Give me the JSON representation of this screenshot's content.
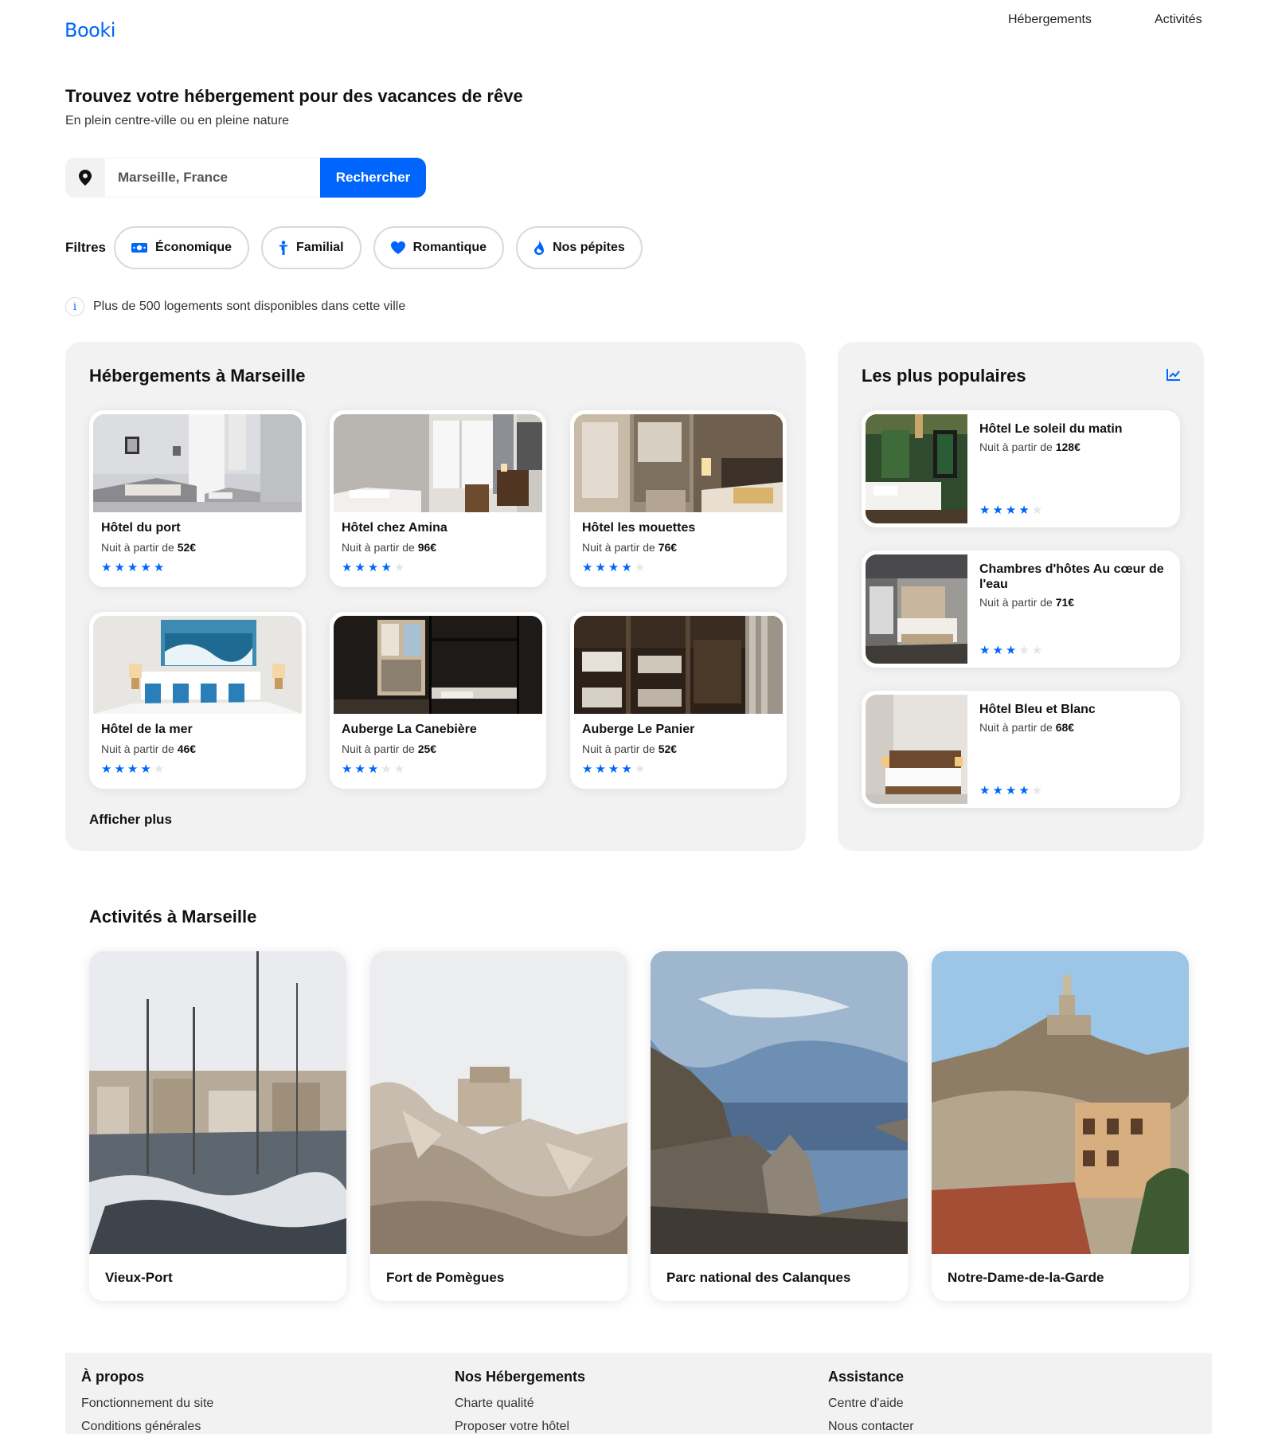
{
  "brand": {
    "logo": "Booki",
    "accent": "#0065fc"
  },
  "nav": {
    "items": [
      "Hébergements",
      "Activités"
    ]
  },
  "hero": {
    "title": "Trouvez votre hébergement pour des vacances de rêve",
    "subtitle": "En plein centre-ville ou en pleine nature"
  },
  "search": {
    "value": "Marseille, France",
    "button": "Rechercher",
    "icon": "map-pin-icon"
  },
  "filters": {
    "label": "Filtres",
    "chips": [
      {
        "label": "Économique",
        "icon": "money-icon"
      },
      {
        "label": "Familial",
        "icon": "child-icon"
      },
      {
        "label": "Romantique",
        "icon": "heart-icon"
      },
      {
        "label": "Nos pépites",
        "icon": "fire-icon"
      }
    ]
  },
  "info": {
    "text": "Plus de 500 logements sont disponibles dans cette ville",
    "icon": "info-icon"
  },
  "hebergements": {
    "title": "Hébergements à Marseille",
    "price_prefix": "Nuit à partir de",
    "more": "Afficher plus",
    "items": [
      {
        "name": "Hôtel du port",
        "price": "52€",
        "stars": 5
      },
      {
        "name": "Hôtel chez Amina",
        "price": "96€",
        "stars": 4
      },
      {
        "name": "Hôtel les mouettes",
        "price": "76€",
        "stars": 4
      },
      {
        "name": "Hôtel de la mer",
        "price": "46€",
        "stars": 4
      },
      {
        "name": "Auberge La Canebière",
        "price": "25€",
        "stars": 3
      },
      {
        "name": "Auberge Le Panier",
        "price": "52€",
        "stars": 4
      }
    ]
  },
  "populaires": {
    "title": "Les plus populaires",
    "icon": "chart-line-icon",
    "price_prefix": "Nuit à partir de",
    "items": [
      {
        "name": "Hôtel Le soleil du matin",
        "price": "128€",
        "stars": 4
      },
      {
        "name": "Chambres d'hôtes Au cœur de l'eau",
        "price": "71€",
        "stars": 3
      },
      {
        "name": "Hôtel Bleu et Blanc",
        "price": "68€",
        "stars": 4
      }
    ]
  },
  "activites": {
    "title": "Activités à Marseille",
    "items": [
      "Vieux-Port",
      "Fort de Pomègues",
      "Parc national des Calanques",
      "Notre-Dame-de-la-Garde"
    ]
  },
  "footer": {
    "columns": [
      {
        "title": "À propos",
        "links": [
          "Fonctionnement du site",
          "Conditions générales"
        ]
      },
      {
        "title": "Nos Hébergements",
        "links": [
          "Charte qualité",
          "Proposer votre hôtel"
        ]
      },
      {
        "title": "Assistance",
        "links": [
          "Centre d'aide",
          "Nous contacter"
        ]
      }
    ]
  }
}
